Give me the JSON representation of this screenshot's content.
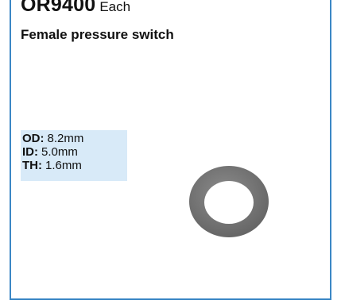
{
  "product": {
    "code": "OR9400",
    "unit": "Each",
    "description": "Female pressure switch"
  },
  "specs": [
    {
      "key": "OD:",
      "value": "8.2mm"
    },
    {
      "key": "ID:",
      "value": "5.0mm"
    },
    {
      "key": "TH:",
      "value": "1.6mm"
    }
  ],
  "colors": {
    "border": "#3b87c5",
    "spec_background": "#d8eaf8",
    "washer": "#7a7a7a"
  }
}
